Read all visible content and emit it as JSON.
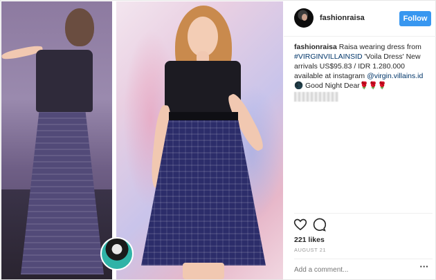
{
  "header": {
    "username": "fashionraisa",
    "follow_label": "Follow"
  },
  "caption": {
    "author": "fashionraisa",
    "text_1": " Raisa wearing dress from ",
    "hashtag": "#VIRGINVILLAINSID",
    "text_2": " 'Voila Dress' New arrivals US$95.83 / IDR 1.280.000 available at instagram ",
    "mention": "@virgin.villains.id",
    "text_3": " 🌑 Good Night Dear🌹🌹🌹"
  },
  "actions": {
    "like_icon": "heart-icon",
    "comment_icon": "comment-icon"
  },
  "likes": "221 likes",
  "date": "AUGUST 21",
  "comment": {
    "placeholder": "Add a comment...",
    "more_label": "···"
  },
  "colors": {
    "follow_blue": "#3897f0",
    "hashtag": "#003569",
    "dress_navy": "#2c2d6a"
  }
}
